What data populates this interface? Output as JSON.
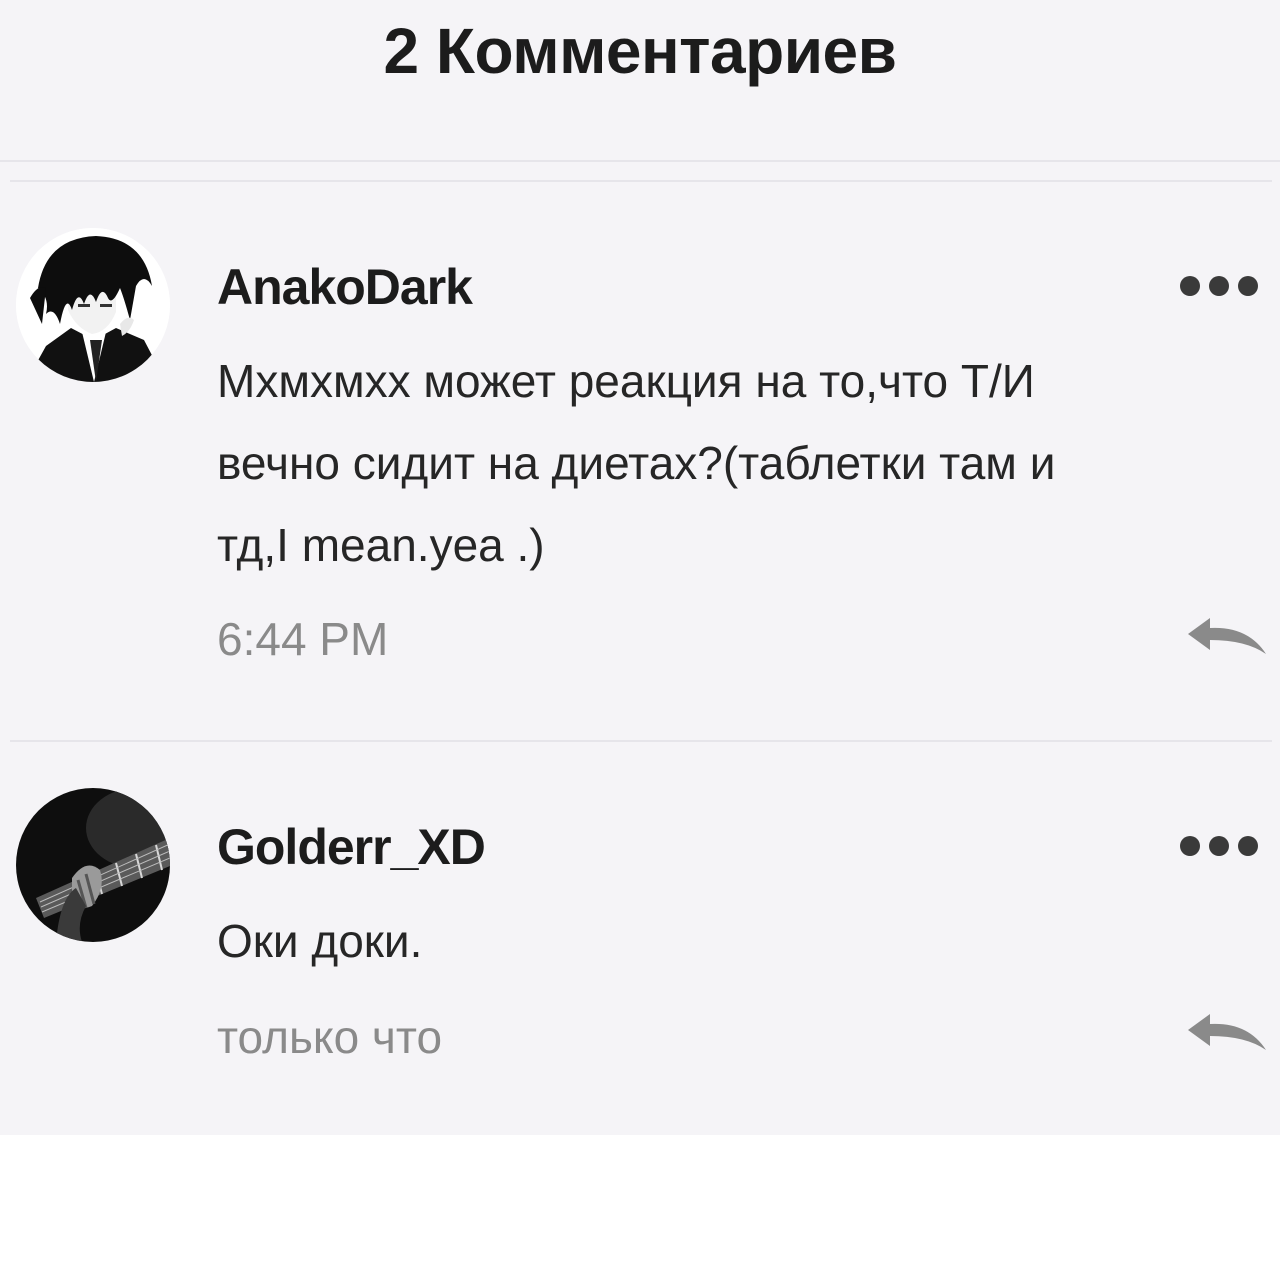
{
  "header": {
    "title": "2 Комментариев"
  },
  "comments": [
    {
      "username": "AnakoDark",
      "avatar_icon": "dark-haired-character-avatar",
      "text": "Мхмхмхх может реакция на то,что Т/И\nвечно сидит на диетах?(таблетки там и\nтд,I mean.yea .)",
      "time": "6:44 PM"
    },
    {
      "username": "Golderr_XD",
      "avatar_icon": "guitar-player-avatar",
      "text": "Оки доки.",
      "time": "только что"
    }
  ],
  "colors": {
    "background": "#f5f4f7",
    "text": "#262626",
    "muted": "#8a8a8a",
    "divider": "#e6e5ea"
  }
}
